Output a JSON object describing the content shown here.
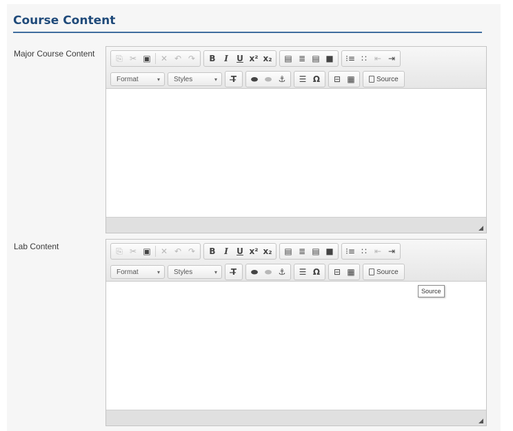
{
  "section": {
    "title": "Course Content"
  },
  "toolbar": {
    "format_label": "Format",
    "styles_label": "Styles",
    "source_label": "Source",
    "combo_arrow": "▾"
  },
  "fields": [
    {
      "label": "Major Course Content"
    },
    {
      "label": "Lab Content"
    }
  ],
  "tooltip": {
    "text": "Source"
  },
  "icons": {
    "copy": "⎘",
    "cut": "✂",
    "paste": "📋",
    "remove-format-x": "✕",
    "undo": "↶",
    "redo": "↷",
    "bold": "B",
    "italic": "I",
    "underline": "U",
    "superscript": "x²",
    "subscript": "x₂",
    "align-left": "≡",
    "align-center": "≡",
    "align-right": "≡",
    "justify": "≡",
    "numbered-list": "⋮≡",
    "bulleted-list": "•≡",
    "outdent": "⇤",
    "indent": "⇥",
    "clear-format": "Tx",
    "link": "⛓",
    "unlink": "⛓",
    "anchor": "⚓",
    "horizontal-rule": "═",
    "special-char": "Ω",
    "iframe": "⊡",
    "table": "▦"
  }
}
